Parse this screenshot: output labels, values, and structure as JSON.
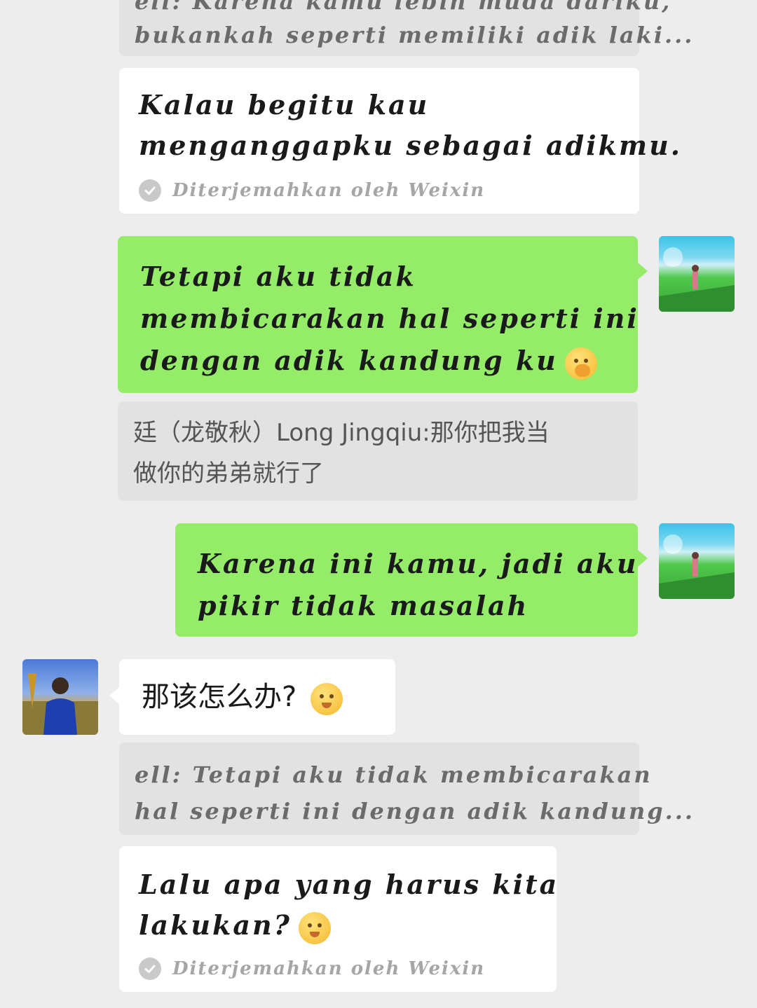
{
  "messages": {
    "m1_quote": {
      "line1": "ell: Karena kamu lebih muda dariku,",
      "line2": "bukankah seperti memiliki adik laki..."
    },
    "m1_bubble": {
      "line1": "Kalau begitu kau",
      "line2": "menganggapku sebagai adikmu.",
      "translated": "Diterjemahkan oleh Weixin"
    },
    "m2_sent": {
      "line1": "Tetapi aku tidak",
      "line2": "membicarakan hal seperti ini",
      "line3": "dengan adik kandung ku"
    },
    "m2_translation": {
      "line1_name": "廷（龙敬秋）Long Jingqiu:",
      "line1_text": "那你把我当",
      "line2": "做你的弟弟就行了"
    },
    "m3_sent": {
      "line1": "Karena ini kamu, jadi aku",
      "line2": "pikir tidak masalah"
    },
    "m4_received": {
      "text": "那该怎么办?"
    },
    "m4_quote": {
      "line1": "ell: Tetapi aku tidak membicarakan",
      "line2": "hal seperti ini dengan adik kandung..."
    },
    "m5_bubble": {
      "line1": "Lalu apa yang harus kita",
      "line2": "lakukan?",
      "translated": "Diterjemahkan oleh Weixin"
    }
  },
  "icons": {
    "emoji": "face-with-hand-over-mouth",
    "check": "check-circle-icon"
  },
  "colors": {
    "background": "#ededed",
    "sent_bubble": "#95ec69",
    "received_bubble": "#ffffff",
    "quote_bubble": "#e2e2e2"
  }
}
